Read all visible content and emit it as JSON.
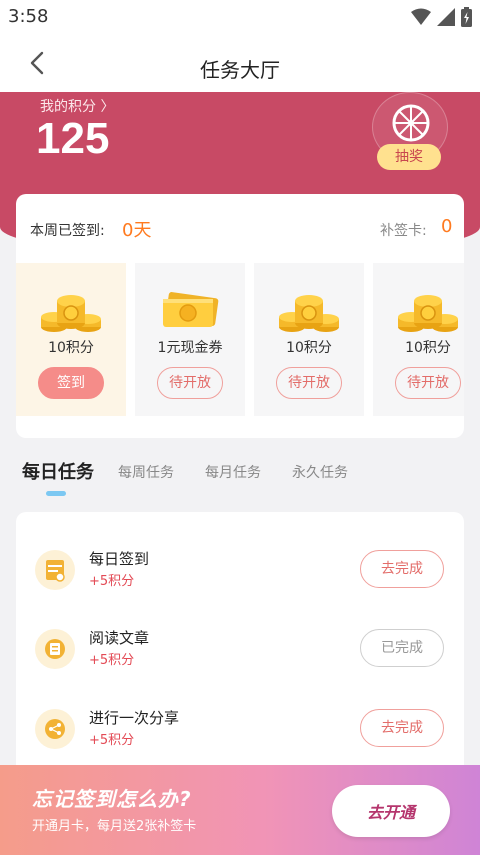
{
  "status_bar": {
    "time": "3:58"
  },
  "nav": {
    "title": "任务大厅"
  },
  "points": {
    "label": "我的积分 〉",
    "value": "125"
  },
  "lottery": {
    "label": "抽奖"
  },
  "signin": {
    "week_label": "本周已签到:",
    "week_value": "0天",
    "makeup_label": "补签卡:",
    "makeup_value": "0",
    "days": [
      {
        "reward": "10积分",
        "button": "签到",
        "state": "active",
        "icon": "coin-stack-icon"
      },
      {
        "reward": "1元现金券",
        "button": "待开放",
        "state": "pending",
        "icon": "cash-coupon-icon"
      },
      {
        "reward": "10积分",
        "button": "待开放",
        "state": "pending",
        "icon": "coin-stack-icon"
      },
      {
        "reward": "10积分",
        "button": "待开放",
        "state": "pending",
        "icon": "coin-stack-icon"
      }
    ]
  },
  "tabs": [
    {
      "label": "每日任务",
      "active": true
    },
    {
      "label": "每周任务",
      "active": false
    },
    {
      "label": "每月任务",
      "active": false
    },
    {
      "label": "永久任务",
      "active": false
    }
  ],
  "tasks": [
    {
      "title": "每日签到",
      "points": "+5积分",
      "button": "去完成",
      "state": "todo",
      "icon": "calendar-icon"
    },
    {
      "title": "阅读文章",
      "points": "+5积分",
      "button": "已完成",
      "state": "done",
      "icon": "article-icon"
    },
    {
      "title": "进行一次分享",
      "points": "+5积分",
      "button": "去完成",
      "state": "todo",
      "icon": "share-icon"
    }
  ],
  "promo": {
    "title": "忘记签到怎么办?",
    "subtitle": "开通月卡，每月送2张补签卡",
    "button": "去开通"
  },
  "colors": {
    "hero": "#c84a65",
    "accent_orange": "#ff7a1f",
    "button_red": "#f58c89",
    "tab_indicator": "#7cc8f2"
  }
}
